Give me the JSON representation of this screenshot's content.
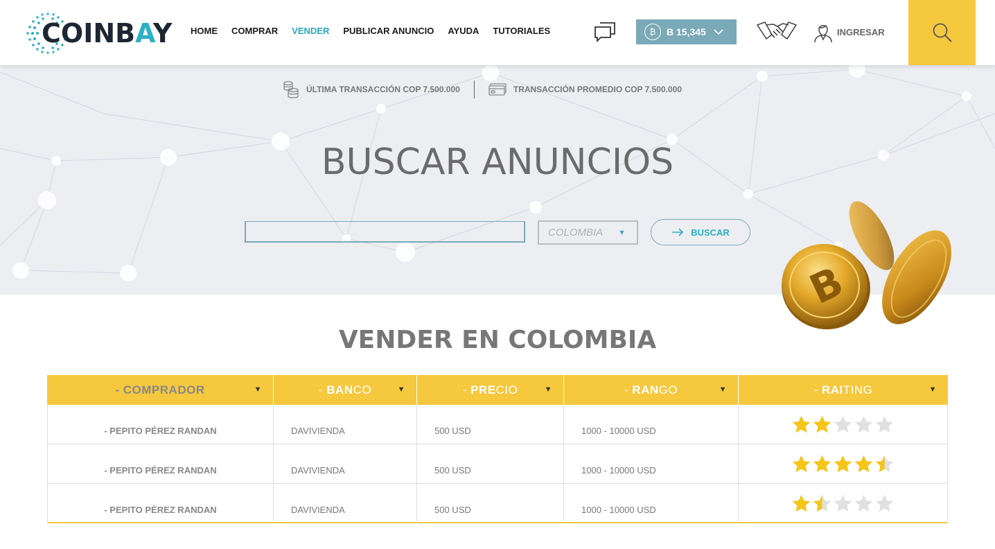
{
  "brand": {
    "name_part1": "CO",
    "name_part2": "INB",
    "name_accent": "A",
    "name_part3": "Y"
  },
  "nav": [
    {
      "label": "HOME",
      "active": false
    },
    {
      "label": "COMPRAR",
      "active": false
    },
    {
      "label": "VENDER",
      "active": true
    },
    {
      "label": "PUBLICAR ANUNCIO",
      "active": false
    },
    {
      "label": "AYUDA",
      "active": false
    },
    {
      "label": "TUTORIALES",
      "active": false
    }
  ],
  "header": {
    "btc_symbol": "₿",
    "btc_balance": "B 15,345",
    "login_label": "INGRESAR"
  },
  "stats": {
    "last_label": "ÚLTIMA TRANSACCIÓN COP 7.500.000",
    "avg_label": "TRANSACCIÓN PROMEDIO COP 7.500.000"
  },
  "hero": {
    "title": "BUSCAR ANUNCIOS",
    "search_value": "",
    "country_selected": "COLOMBIA",
    "search_button": "BUSCAR"
  },
  "section": {
    "title_bold": "VENDER",
    "title_rest": " EN COLOMBIA"
  },
  "table": {
    "columns": [
      {
        "prefix": "- ",
        "bold": "COMPRA",
        "rest": "DOR"
      },
      {
        "prefix": "- ",
        "bold": "BAN",
        "rest": "CO"
      },
      {
        "prefix": "- ",
        "bold": "PRE",
        "rest": "CIO"
      },
      {
        "prefix": "- ",
        "bold": "RAN",
        "rest": "GO"
      },
      {
        "prefix": "- ",
        "bold": "RAI",
        "rest": "TING"
      }
    ],
    "rows": [
      {
        "buyer": "- PEPITO PÉREZ RANDAN",
        "bank": "DAVIVIENDA",
        "price": "500 USD",
        "range": "1000 - 10000 USD",
        "rating": 2
      },
      {
        "buyer": "- PEPITO PÉREZ RANDAN",
        "bank": "DAVIVIENDA",
        "price": "500 USD",
        "range": "1000 - 10000 USD",
        "rating": 4.5
      },
      {
        "buyer": "- PEPITO PÉREZ RANDAN",
        "bank": "DAVIVIENDA",
        "price": "500 USD",
        "range": "1000 - 10000 USD",
        "rating": 1.5
      }
    ]
  },
  "colors": {
    "accent_yellow": "#f6c83e",
    "accent_teal": "#2bb0c4",
    "balance_bg": "#7aa9b8",
    "hero_bg": "#eceef2",
    "star_filled": "#f5c518",
    "star_empty": "#e0e0e0"
  }
}
